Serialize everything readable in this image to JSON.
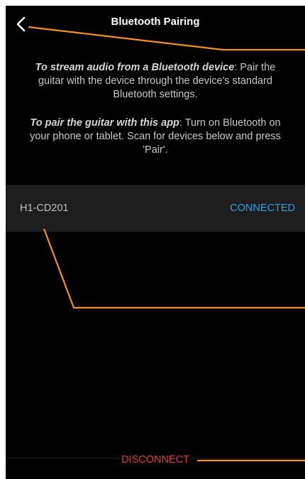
{
  "header": {
    "title": "Bluetooth Pairing",
    "back_icon": "chevron-left-icon"
  },
  "instructions": {
    "stream_heading": "To stream audio from a Bluetooth device",
    "stream_text": ": Pair the guitar with the device through the device's standard Bluetooth settings.",
    "pair_heading": "To pair the guitar with this app",
    "pair_text": ": Turn on Bluetooth on your phone or tablet. Scan for devices below and press 'Pair'."
  },
  "devices": [
    {
      "name": "H1-CD201",
      "status": "CONNECTED"
    }
  ],
  "footer": {
    "disconnect_label": "DISCONNECT"
  },
  "colors": {
    "background": "#000000",
    "row_background": "#1e1e1e",
    "connected": "#2f9fe0",
    "disconnect": "#e53935",
    "callout": "#f5901e"
  }
}
